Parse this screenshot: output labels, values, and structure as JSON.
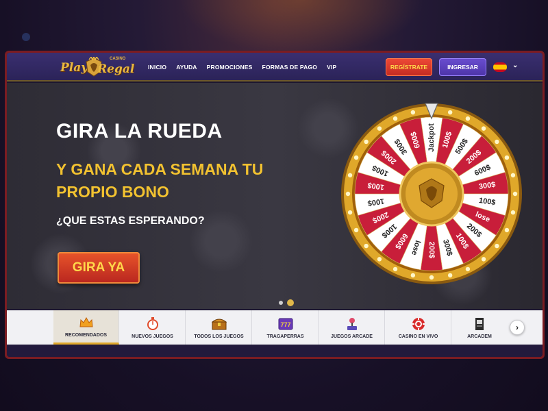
{
  "brand": {
    "logo_play": "Play",
    "logo_regal": "Regal",
    "logo_casino": "CASINO"
  },
  "nav": {
    "items": [
      "INICIO",
      "AYUDA",
      "PROMOCIONES",
      "FORMAS DE PAGO",
      "VIP"
    ]
  },
  "header": {
    "register_label": "REGÍSTRATE",
    "login_label": "INGRESAR",
    "language_icon": "spain-flag-icon"
  },
  "hero": {
    "title": "GIRA LA RUEDA",
    "subtitle": "Y GANA CADA SEMANA TU PROPIO BONO",
    "question": "¿QUE ESTAS ESPERANDO?",
    "cta_label": "GIRA YA",
    "slide_count": 2,
    "active_slide": 2
  },
  "wheel": {
    "segments": [
      "Jackpot",
      "100$",
      "500$",
      "200$",
      "600$",
      "300$",
      "100$",
      "lose",
      "200$",
      "100$",
      "300$",
      "200$",
      "lose",
      "600$",
      "100$",
      "200$",
      "100$",
      "100$",
      "100$",
      "200$",
      "300$",
      "600$"
    ],
    "colors": {
      "red": "#c81e3a",
      "white": "#ffffff",
      "gold": "#e0a82a"
    }
  },
  "categories": {
    "items": [
      {
        "label": "RECOMENDADOS",
        "icon": "crown-icon",
        "active": true
      },
      {
        "label": "NUEVOS JUEGOS",
        "icon": "stopwatch-icon",
        "active": false
      },
      {
        "label": "TODOS LOS JUEGOS",
        "icon": "treasure-chest-icon",
        "active": false
      },
      {
        "label": "TRAGAPERRAS",
        "icon": "slot-777-icon",
        "active": false
      },
      {
        "label": "JUEGOS ARCADE",
        "icon": "joystick-icon",
        "active": false
      },
      {
        "label": "CASINO EN VIVO",
        "icon": "poker-chip-icon",
        "active": false
      },
      {
        "label": "ARCADEM",
        "icon": "arcade-cabinet-icon",
        "active": false
      }
    ],
    "next_icon": "chevron-right-icon"
  }
}
